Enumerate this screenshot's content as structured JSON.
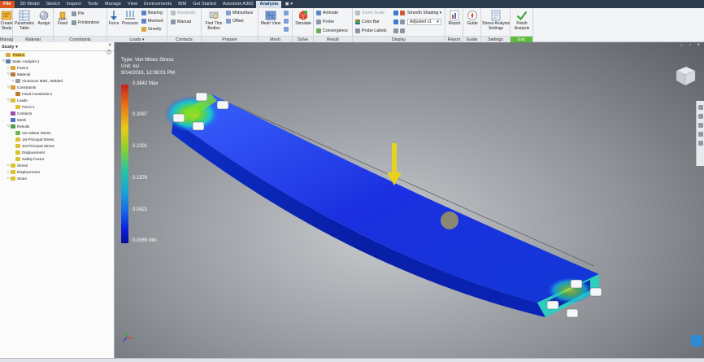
{
  "tabs": [
    "File",
    "3D Model",
    "Sketch",
    "Inspect",
    "Tools",
    "Manage",
    "View",
    "Environments",
    "BIM",
    "Get Started",
    "Autodesk A360",
    "Analysis"
  ],
  "active_tab": "Analysis",
  "extra_tab_icon": "camera-icon",
  "ribbon": {
    "manage": {
      "label": "Manage",
      "create_study": "Create Study"
    },
    "material": {
      "label": "Material",
      "assign": "Assign"
    },
    "constraints": {
      "label": "Constraints",
      "parametric_table": "Parametric Table",
      "fixed": "Fixed",
      "pin": "Pin",
      "frictionless": "Frictionless"
    },
    "loads": {
      "label": "Loads",
      "force": "Force",
      "pressure": "Pressure",
      "bearing": "Bearing",
      "moment": "Moment",
      "gravity": "Gravity"
    },
    "contacts": {
      "label": "Contacts",
      "automatic": "Automatic",
      "manual": "Manual"
    },
    "prepare": {
      "label": "Prepare",
      "find_thin_bodies": "Find Thin Bodies",
      "midsurface": "Midsurface",
      "offset": "Offset"
    },
    "mesh": {
      "label": "Mesh",
      "mesh_view": "Mesh View"
    },
    "solve": {
      "label": "Solve",
      "simulate": "Simulate"
    },
    "result": {
      "label": "Result",
      "animate": "Animate",
      "probe": "Probe",
      "convergence": "Convergence"
    },
    "display": {
      "label": "Display",
      "same_scale": "Same Scale",
      "color_bar": "Color Bar",
      "probe_labels": "Probe Labels",
      "smooth_shading": "Smooth Shading",
      "adjusted": "Adjusted x1"
    },
    "report": {
      "label": "Report",
      "report": "Report"
    },
    "guide": {
      "label": "Guide",
      "guide": "Guide"
    },
    "settings": {
      "label": "Settings",
      "stress_analysis_settings": "Stress Analysis Settings"
    },
    "exit": {
      "label": "Exit",
      "finish_analysis": "Finish Analysis"
    }
  },
  "browser": {
    "header": "Study",
    "items": [
      {
        "label": "Part13",
        "depth": 0,
        "expand": "",
        "icon_color": "#d8a83a",
        "selected": true
      },
      {
        "label": "Static Analysis:1",
        "depth": 0,
        "expand": "▽",
        "icon_color": "#5a7fb2",
        "selected": false
      },
      {
        "label": "Part13",
        "depth": 1,
        "expand": "▹",
        "icon_color": "#d8a83a",
        "selected": false
      },
      {
        "label": "Material",
        "depth": 1,
        "expand": "▽",
        "icon_color": "#b07a3a",
        "selected": false
      },
      {
        "label": "Aluminum 6061, Welded",
        "depth": 2,
        "expand": "▹",
        "icon_color": "#9a9a9a",
        "selected": false
      },
      {
        "label": "Constraints",
        "depth": 1,
        "expand": "▽",
        "icon_color": "#d99a2a",
        "selected": false
      },
      {
        "label": "Fixed Constraint:1",
        "depth": 2,
        "expand": "",
        "icon_color": "#c07a2a",
        "selected": false
      },
      {
        "label": "Loads",
        "depth": 1,
        "expand": "▽",
        "icon_color": "#d9c22a",
        "selected": false
      },
      {
        "label": "Force:1",
        "depth": 2,
        "expand": "",
        "icon_color": "#d9c22a",
        "selected": false
      },
      {
        "label": "Contacts",
        "depth": 1,
        "expand": "",
        "icon_color": "#9b4ea8",
        "selected": false
      },
      {
        "label": "Mesh",
        "depth": 1,
        "expand": "",
        "icon_color": "#4a6fc4",
        "selected": false
      },
      {
        "label": "Results",
        "depth": 1,
        "expand": "▽",
        "icon_color": "#4aa14a",
        "selected": false
      },
      {
        "label": "Von Mises Stress",
        "depth": 2,
        "expand": "",
        "icon_color": "#6bb84a",
        "selected": false
      },
      {
        "label": "1st Principal Stress",
        "depth": 2,
        "expand": "",
        "icon_color": "#d9c22a",
        "selected": false
      },
      {
        "label": "3rd Principal Stress",
        "depth": 2,
        "expand": "",
        "icon_color": "#d9c22a",
        "selected": false
      },
      {
        "label": "Displacement",
        "depth": 2,
        "expand": "",
        "icon_color": "#d9c22a",
        "selected": false
      },
      {
        "label": "Safety Factor",
        "depth": 2,
        "expand": "",
        "icon_color": "#d9c22a",
        "selected": false
      },
      {
        "label": "Stress",
        "depth": 1,
        "expand": "▹",
        "icon_color": "#d9c22a",
        "selected": false
      },
      {
        "label": "Displacement",
        "depth": 1,
        "expand": "▹",
        "icon_color": "#d9c22a",
        "selected": false
      },
      {
        "label": "Strain",
        "depth": 1,
        "expand": "▹",
        "icon_color": "#d9c22a",
        "selected": false
      }
    ]
  },
  "viewport": {
    "type_label": "Type: Von Mises Stress",
    "unit_label": "Unit: ksi",
    "timestamp": "9/14/2016, 12:08:01 PM",
    "max_label": "0.3842 Max",
    "min_label": "0.0065 Min",
    "ticks": [
      "0.3087",
      "0.2331",
      "0.1576",
      "0.0821"
    ],
    "arrow_color": "#e8d21c"
  }
}
